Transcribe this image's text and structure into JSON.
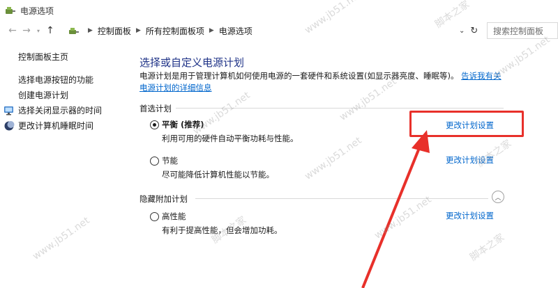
{
  "window": {
    "title": "电源选项"
  },
  "address": {
    "crumbs": [
      "控制面板",
      "所有控制面板项",
      "电源选项"
    ],
    "search_placeholder": "搜索控制面板"
  },
  "sidebar": {
    "items": [
      {
        "label": "控制面板主页",
        "icon": ""
      },
      {
        "label": "选择电源按钮的功能",
        "icon": ""
      },
      {
        "label": "创建电源计划",
        "icon": ""
      },
      {
        "label": "选择关闭显示器的时间",
        "icon": "monitor-icon"
      },
      {
        "label": "更改计算机睡眠时间",
        "icon": "moon-icon"
      }
    ]
  },
  "main": {
    "heading": "选择或自定义电源计划",
    "description": "电源计划是用于管理计算机如何使用电源的一套硬件和系统设置(如显示器亮度、睡眠等)。",
    "description_link": "告诉我有关电源计划的详细信息",
    "preferred_label": "首选计划",
    "hidden_label": "隐藏附加计划",
    "plans": [
      {
        "name": "平衡 (推荐)",
        "desc": "利用可用的硬件自动平衡功耗与性能。",
        "checked": true,
        "link": "更改计划设置"
      },
      {
        "name": "节能",
        "desc": "尽可能降低计算机性能以节能。",
        "checked": false,
        "link": "更改计划设置"
      },
      {
        "name": "高性能",
        "desc": "有利于提高性能，但会增加功耗。",
        "checked": false,
        "link": "更改计划设置"
      }
    ]
  },
  "colors": {
    "heading": "#1e3287",
    "link": "#0066cc",
    "annotation": "#e8302a"
  },
  "watermark": {
    "text_latin": "www.jb51.net",
    "text_cjk": "脚本之家"
  }
}
